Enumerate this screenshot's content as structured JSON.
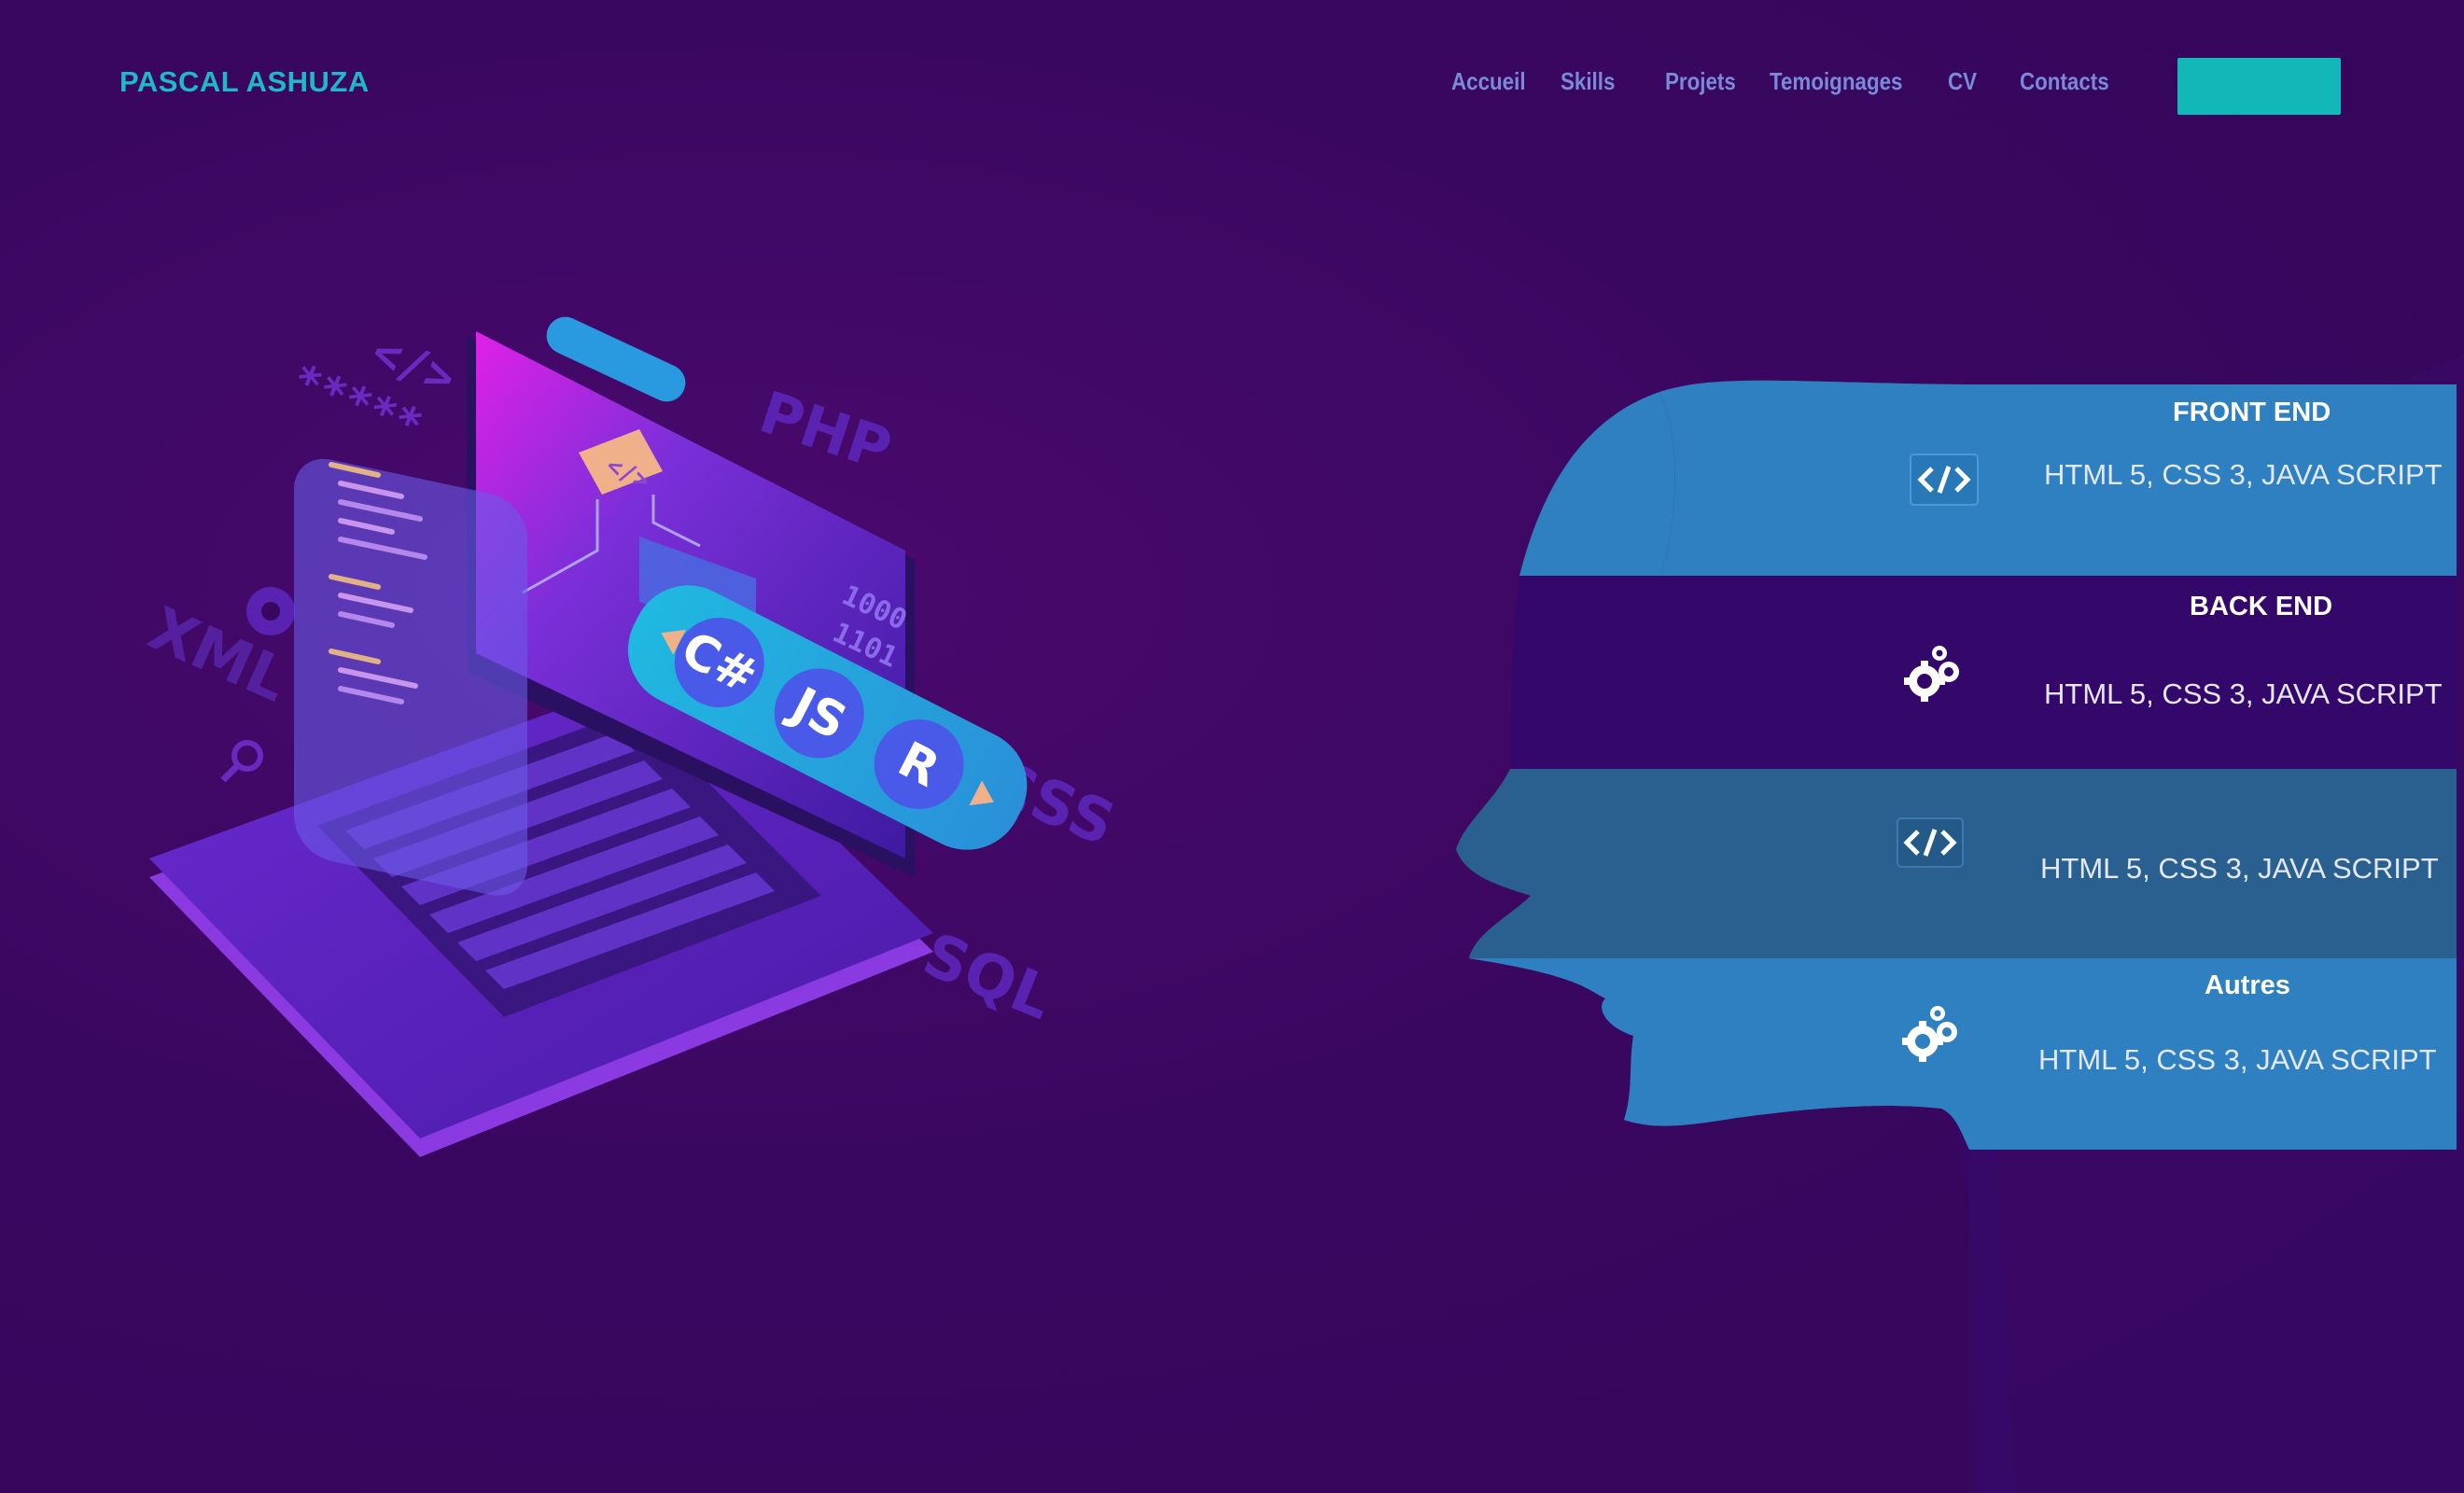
{
  "brand": {
    "name": "PASCAL ASHUZA"
  },
  "nav": {
    "items": [
      {
        "label": "Accueil"
      },
      {
        "label": "Skills"
      },
      {
        "label": "Projets"
      },
      {
        "label": "Temoignages"
      },
      {
        "label": "CV"
      },
      {
        "label": "Contacts"
      }
    ],
    "cta_label": ""
  },
  "illustration": {
    "labels": [
      "PHP",
      "XML",
      "CSS",
      "SQL",
      "C#",
      "JS",
      "R"
    ]
  },
  "skills": [
    {
      "title": "FRONT END",
      "desc": "HTML 5, CSS 3, JAVA SCRIPT",
      "icon": "code-icon"
    },
    {
      "title": "BACK END",
      "desc": "HTML 5, CSS 3, JAVA SCRIPT",
      "icon": "gears-icon"
    },
    {
      "title": "",
      "desc": "HTML 5, CSS 3, JAVA SCRIPT",
      "icon": "code-icon"
    },
    {
      "title": "Autres",
      "desc": "HTML 5, CSS 3, JAVA SCRIPT",
      "icon": "gears-icon"
    }
  ],
  "colors": {
    "background": "#3a0760",
    "brand": "#1fb8c6",
    "nav_text": "#7a8ad8",
    "cta": "#12b7b8",
    "panel_blue": "#2f80c0",
    "panel_dark": "#2a6090"
  }
}
